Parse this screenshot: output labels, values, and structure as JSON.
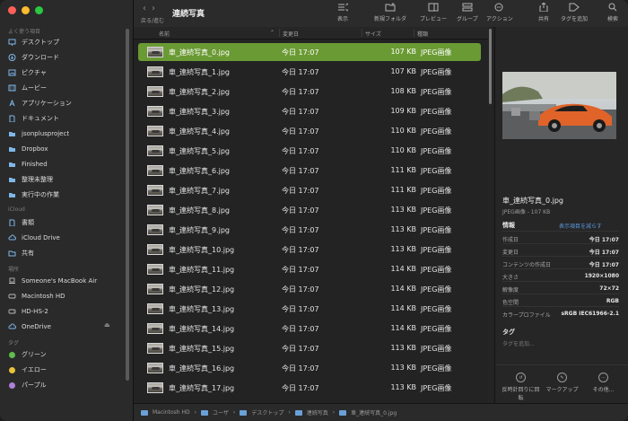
{
  "window": {
    "title": "連続写真"
  },
  "toolbar": {
    "back_forward_label": "戻る/進む",
    "view_label": "表示",
    "new_folder_label": "新規フォルダ",
    "preview_label": "プレビュー",
    "group_label": "グループ",
    "action_label": "アクション",
    "share_label": "共有",
    "add_tag_label": "タグを追加",
    "search_label": "検索"
  },
  "sidebar": {
    "section_favorites": "よく使う項目",
    "favorites": [
      {
        "label": "デスクトップ",
        "icon": "desktop-icon"
      },
      {
        "label": "ダウンロード",
        "icon": "download-icon"
      },
      {
        "label": "ピクチャ",
        "icon": "pictures-icon"
      },
      {
        "label": "ムービー",
        "icon": "movies-icon"
      },
      {
        "label": "アプリケーション",
        "icon": "applications-icon"
      },
      {
        "label": "ドキュメント",
        "icon": "documents-icon"
      },
      {
        "label": "jsonplusproject",
        "icon": "folder-icon"
      },
      {
        "label": "Dropbox",
        "icon": "folder-icon"
      },
      {
        "label": "Finished",
        "icon": "folder-icon"
      },
      {
        "label": "整理未整理",
        "icon": "folder-icon"
      },
      {
        "label": "実行中の作業",
        "icon": "folder-icon"
      }
    ],
    "section_icloud": "iCloud",
    "icloud": [
      {
        "label": "書類",
        "icon": "document-icon"
      },
      {
        "label": "iCloud Drive",
        "icon": "cloud-icon"
      },
      {
        "label": "共有",
        "icon": "shared-folder-icon"
      }
    ],
    "section_locations": "場所",
    "locations": [
      {
        "label": "Someone's MacBook Air",
        "icon": "laptop-icon"
      },
      {
        "label": "Macintosh HD",
        "icon": "drive-icon"
      },
      {
        "label": "HD-HS-2",
        "icon": "external-drive-icon"
      },
      {
        "label": "OneDrive",
        "icon": "cloud-icon"
      }
    ],
    "section_tags": "タグ",
    "tags": [
      {
        "label": "グリーン",
        "color": "#5fbf4d"
      },
      {
        "label": "イエロー",
        "color": "#e8c33b"
      },
      {
        "label": "パープル",
        "color": "#b07fd6"
      }
    ]
  },
  "columns": {
    "name": "名前",
    "date": "変更日",
    "size": "サイズ",
    "kind": "種類"
  },
  "files": [
    {
      "name": "車_連続写真_0.jpg",
      "date": "今日 17:07",
      "size": "107 KB",
      "kind": "JPEG画像",
      "selected": true
    },
    {
      "name": "車_連続写真_1.jpg",
      "date": "今日 17:07",
      "size": "107 KB",
      "kind": "JPEG画像"
    },
    {
      "name": "車_連続写真_2.jpg",
      "date": "今日 17:07",
      "size": "108 KB",
      "kind": "JPEG画像"
    },
    {
      "name": "車_連続写真_3.jpg",
      "date": "今日 17:07",
      "size": "109 KB",
      "kind": "JPEG画像"
    },
    {
      "name": "車_連続写真_4.jpg",
      "date": "今日 17:07",
      "size": "110 KB",
      "kind": "JPEG画像"
    },
    {
      "name": "車_連続写真_5.jpg",
      "date": "今日 17:07",
      "size": "110 KB",
      "kind": "JPEG画像"
    },
    {
      "name": "車_連続写真_6.jpg",
      "date": "今日 17:07",
      "size": "111 KB",
      "kind": "JPEG画像"
    },
    {
      "name": "車_連続写真_7.jpg",
      "date": "今日 17:07",
      "size": "111 KB",
      "kind": "JPEG画像"
    },
    {
      "name": "車_連続写真_8.jpg",
      "date": "今日 17:07",
      "size": "113 KB",
      "kind": "JPEG画像"
    },
    {
      "name": "車_連続写真_9.jpg",
      "date": "今日 17:07",
      "size": "113 KB",
      "kind": "JPEG画像"
    },
    {
      "name": "車_連続写真_10.jpg",
      "date": "今日 17:07",
      "size": "113 KB",
      "kind": "JPEG画像"
    },
    {
      "name": "車_連続写真_11.jpg",
      "date": "今日 17:07",
      "size": "114 KB",
      "kind": "JPEG画像"
    },
    {
      "name": "車_連続写真_12.jpg",
      "date": "今日 17:07",
      "size": "114 KB",
      "kind": "JPEG画像"
    },
    {
      "name": "車_連続写真_13.jpg",
      "date": "今日 17:07",
      "size": "114 KB",
      "kind": "JPEG画像"
    },
    {
      "name": "車_連続写真_14.jpg",
      "date": "今日 17:07",
      "size": "114 KB",
      "kind": "JPEG画像"
    },
    {
      "name": "車_連続写真_15.jpg",
      "date": "今日 17:07",
      "size": "113 KB",
      "kind": "JPEG画像"
    },
    {
      "name": "車_連続写真_16.jpg",
      "date": "今日 17:07",
      "size": "113 KB",
      "kind": "JPEG画像"
    },
    {
      "name": "車_連続写真_17.jpg",
      "date": "今日 17:07",
      "size": "113 KB",
      "kind": "JPEG画像"
    }
  ],
  "path": [
    "Macintosh HD",
    "ユーザ",
    "デスクトップ",
    "連続写真",
    "車_連続写真_0.jpg"
  ],
  "preview": {
    "name": "車_連続写真_0.jpg",
    "subtitle": "JPEG画像 - 107 KB",
    "info_title": "情報",
    "show_more": "表示項目を減らす",
    "info": [
      {
        "key": "作成日",
        "value": "今日 17:07"
      },
      {
        "key": "変更日",
        "value": "今日 17:07"
      },
      {
        "key": "コンテンツの作成日",
        "value": "今日 17:07"
      },
      {
        "key": "大きさ",
        "value": "1920×1080"
      },
      {
        "key": "解像度",
        "value": "72×72"
      },
      {
        "key": "色空間",
        "value": "RGB"
      },
      {
        "key": "カラープロファイル",
        "value": "sRGB IEC61966-2.1"
      }
    ],
    "tags_title": "タグ",
    "tags_placeholder": "タグを追加...",
    "actions": [
      {
        "label": "反時計回りに回転",
        "icon": "rotate-left-icon"
      },
      {
        "label": "マークアップ",
        "icon": "markup-icon"
      },
      {
        "label": "その他...",
        "icon": "more-icon"
      }
    ]
  },
  "colors": {
    "selection": "#6a9a33",
    "accent_link": "#5b9be0"
  }
}
